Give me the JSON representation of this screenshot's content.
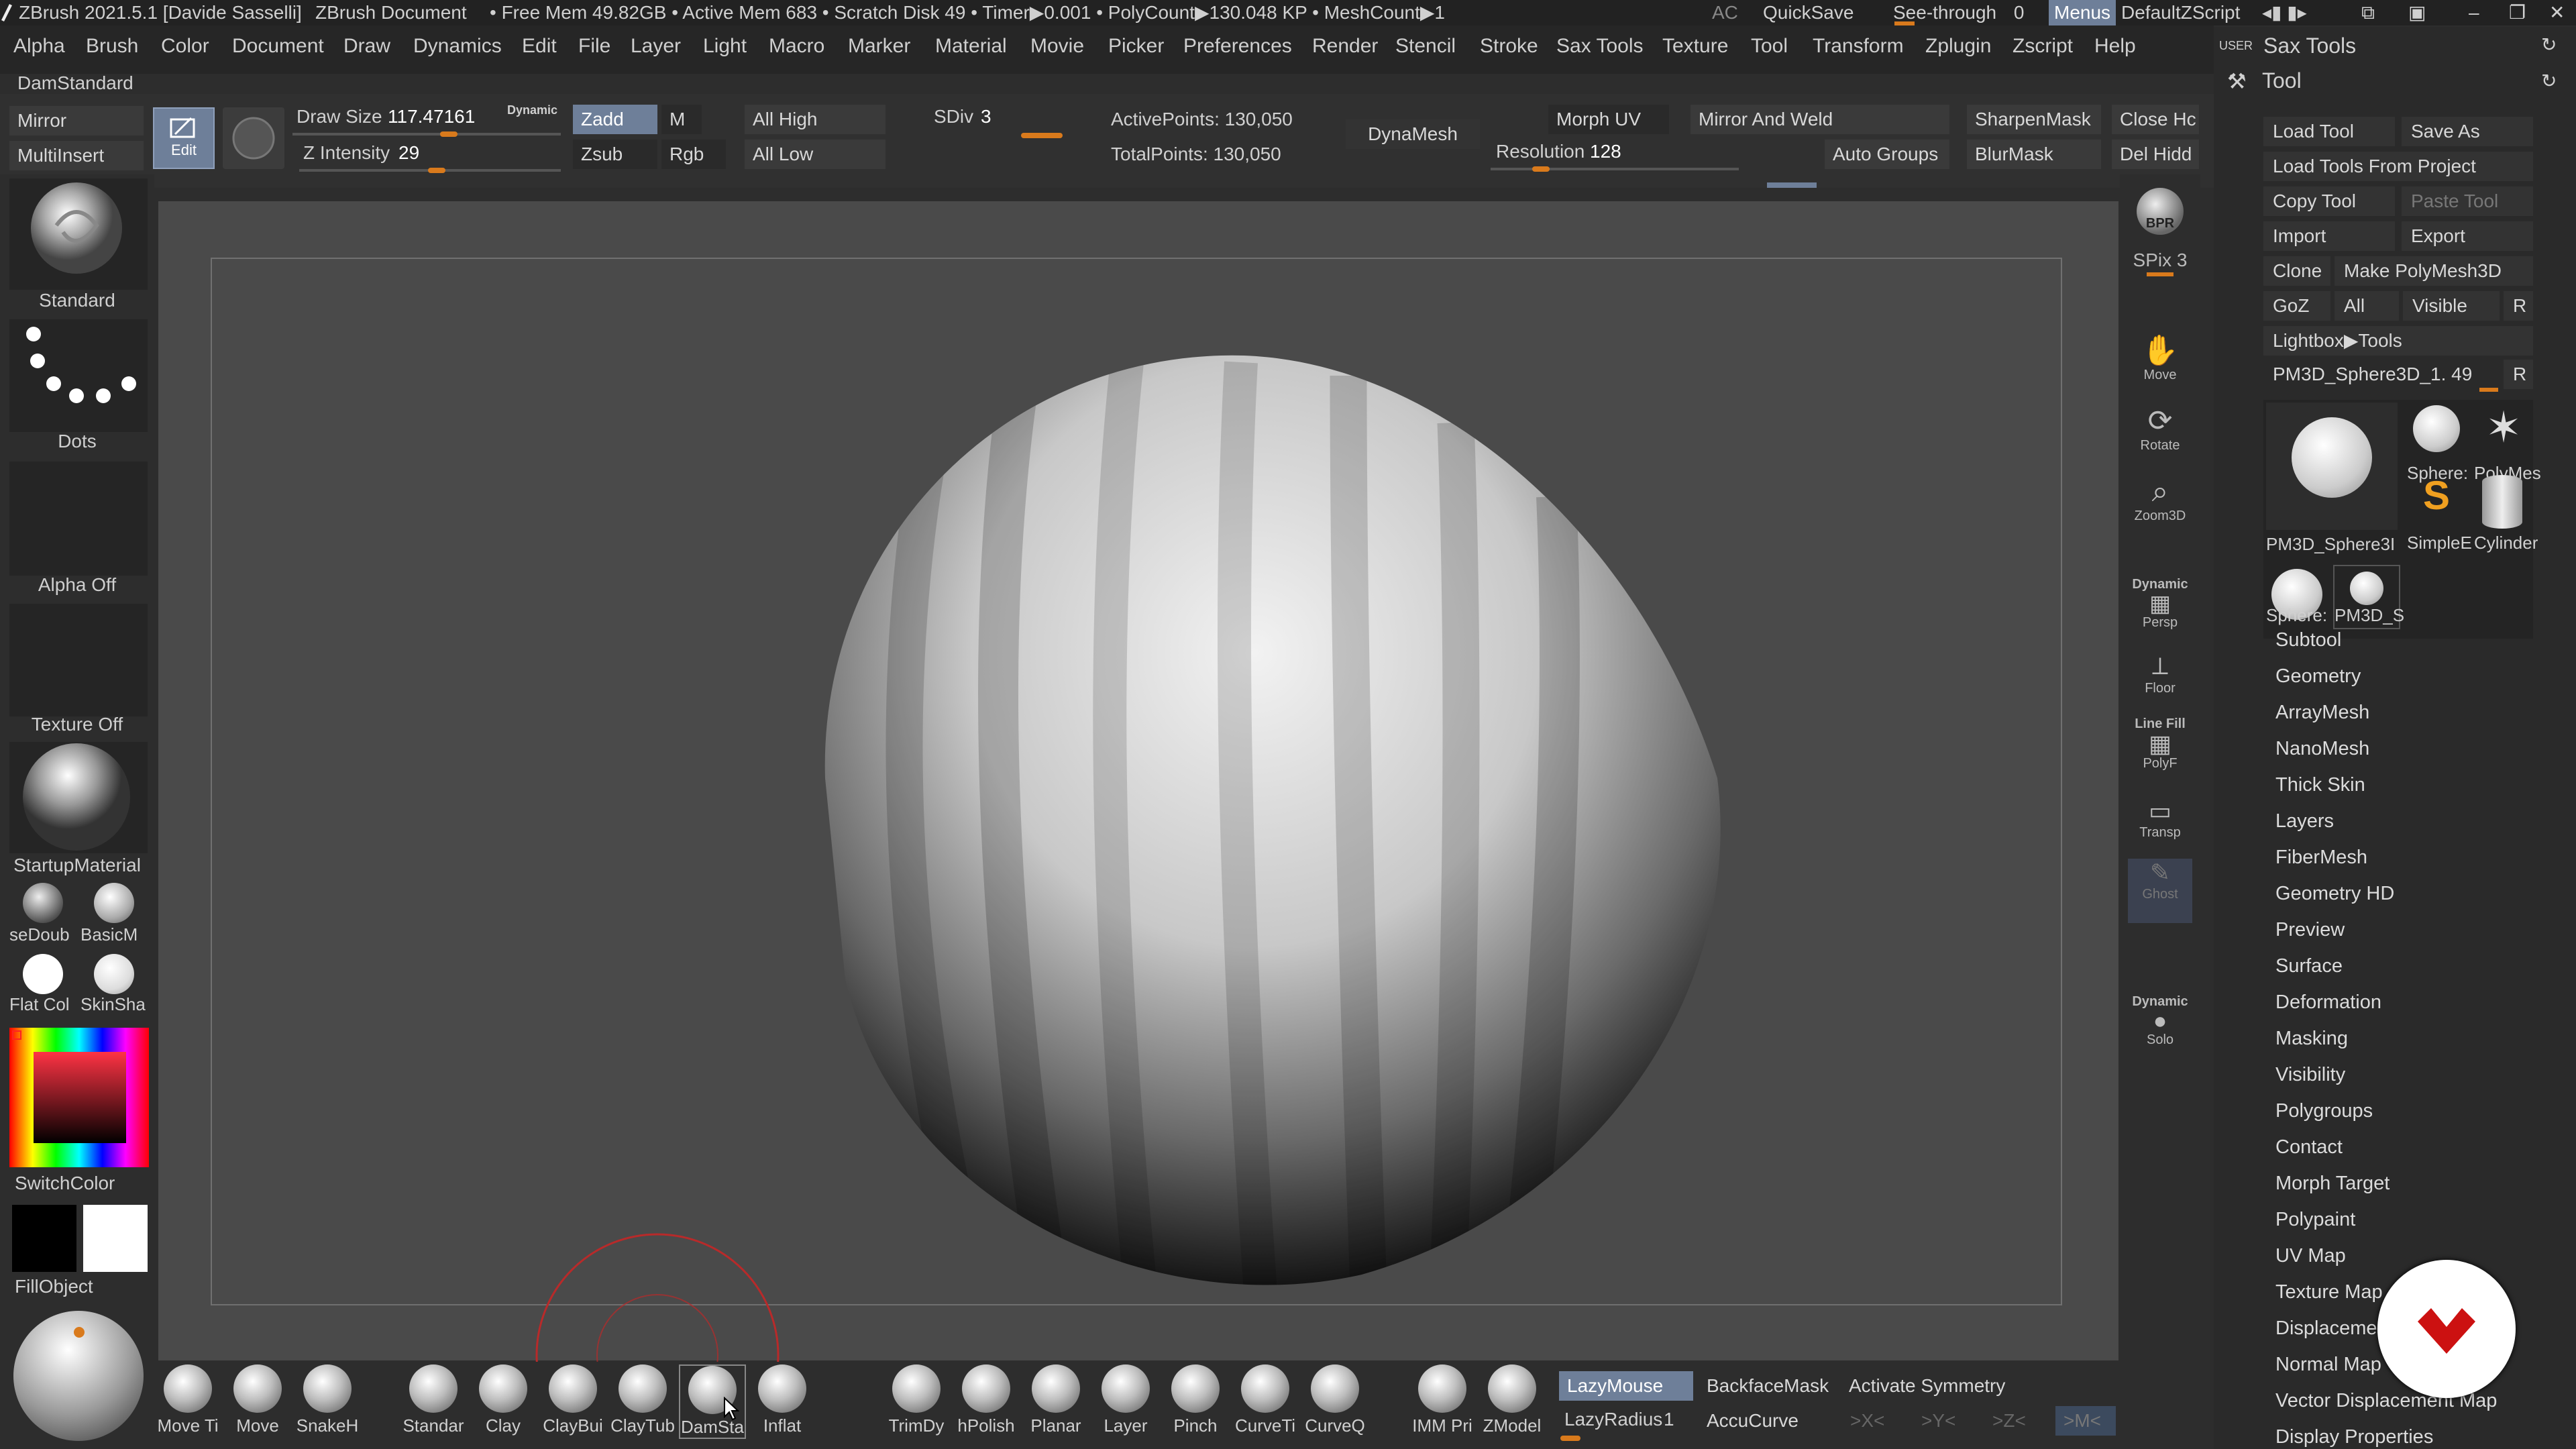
{
  "titlebar": {
    "app": "ZBrush 2021.5.1 [Davide Sasselli]",
    "doc": "ZBrush Document",
    "stats": "• Free Mem 49.82GB • Active Mem 683 • Scratch Disk 49 • Timer▶0.001 • PolyCount▶130.048 KP • MeshCount▶1",
    "ac": "AC",
    "quicksave": "QuickSave",
    "seethrough": "See-through",
    "seethrough_val": "0",
    "menus": "Menus",
    "script": "DefaultZScript"
  },
  "menus": [
    "Alpha",
    "Brush",
    "Color",
    "Document",
    "Draw",
    "Dynamics",
    "Edit",
    "File",
    "Layer",
    "Light",
    "Macro",
    "Marker",
    "Material",
    "Movie",
    "Picker",
    "Preferences",
    "Render",
    "Stencil",
    "Stroke",
    "Sax Tools",
    "Texture",
    "Tool",
    "Transform",
    "Zplugin",
    "Zscript",
    "Help"
  ],
  "current_brush": "DamStandard",
  "shelf": {
    "mirror": "Mirror",
    "multiinsert": "MultiInsert",
    "edit": "Edit",
    "draw_size_label": "Draw Size",
    "draw_size_value": "117.47161",
    "dynamic": "Dynamic",
    "z_intensity_label": "Z Intensity",
    "z_intensity_value": "29",
    "zadd": "Zadd",
    "zsub": "Zsub",
    "m": "M",
    "rgb": "Rgb",
    "all_high": "All High",
    "all_low": "All Low",
    "sdiv_label": "SDiv",
    "sdiv_value": "3",
    "active_points": "ActivePoints: 130,050",
    "total_points": "TotalPoints: 130,050",
    "dynamesh": "DynaMesh",
    "morph_uv": "Morph UV",
    "resolution_label": "Resolution",
    "resolution_value": "128",
    "mirror_weld": "Mirror And Weld",
    "auto_groups": "Auto Groups",
    "sharpenmask": "SharpenMask",
    "blurmask": "BlurMask",
    "close_holes": "Close Hc",
    "del_hidden": "Del Hidd"
  },
  "left": {
    "standard": "Standard",
    "dots": "Dots",
    "alpha_off": "Alpha Off",
    "texture_off": "Texture Off",
    "startup_material": "StartupMaterial",
    "mat1": "seDoub",
    "mat2": "BasicM",
    "mat3": "Flat Col",
    "mat4": "SkinSha",
    "switch_color": "SwitchColor",
    "fill_object": "FillObject"
  },
  "right": {
    "bpr": "BPR",
    "spix_label": "SPix",
    "spix_value": "3",
    "move": "Move",
    "rotate": "Rotate",
    "zoom3d": "Zoom3D",
    "dynamic": "Dynamic",
    "persp": "Persp",
    "floor": "Floor",
    "linefill": "Line Fill",
    "polyf": "PolyF",
    "transp": "Transp",
    "ghost": "Ghost",
    "dynamic2": "Dynamic",
    "solo": "Solo"
  },
  "toolpanel": {
    "user": "USER",
    "sax_tools": "Sax Tools",
    "tool": "Tool",
    "load_tool": "Load Tool",
    "save_as": "Save As",
    "load_from_project": "Load Tools From Project",
    "copy_tool": "Copy Tool",
    "paste_tool": "Paste Tool",
    "import": "Import",
    "export": "Export",
    "clone": "Clone",
    "make_polymesh": "Make PolyMesh3D",
    "goz": "GoZ",
    "all": "All",
    "visible": "Visible",
    "r": "R",
    "lightbox_tools": "Lightbox▶Tools",
    "current_tool": "PM3D_Sphere3D_1. 49",
    "r2": "R",
    "thumb_main": "PM3D_Sphere3I",
    "thumb_sphere": "Sphere:",
    "thumb_polymesh": "PolyMes",
    "thumb_simple": "SimpleE",
    "thumb_cylinder": "Cylinder",
    "thumb_sphere2": "Sphere:",
    "thumb_pm3d": "PM3D_S",
    "sections": [
      "Subtool",
      "Geometry",
      "ArrayMesh",
      "NanoMesh",
      "Thick Skin",
      "Layers",
      "FiberMesh",
      "Geometry HD",
      "Preview",
      "Surface",
      "Deformation",
      "Masking",
      "Visibility",
      "Polygroups",
      "Contact",
      "Morph Target",
      "Polypaint",
      "UV Map",
      "Texture Map",
      "Displacement",
      "Normal Map",
      "Vector Displacement Map",
      "Display Properties"
    ]
  },
  "bottom": {
    "brushes": [
      "Move Ti",
      "Move",
      "SnakeH",
      "Standar",
      "Clay",
      "ClayBui",
      "ClayTub",
      "DamSta",
      "Inflat",
      "TrimDy",
      "hPolish",
      "Planar",
      "Layer",
      "Pinch",
      "CurveTi",
      "CurveQ",
      "IMM Pri",
      "ZModel"
    ],
    "lazymouse": "LazyMouse",
    "lazyradius_label": "LazyRadius",
    "lazyradius_value": "1",
    "backfacemask": "BackfaceMask",
    "accucurve": "AccuCurve",
    "activate_symmetry": "Activate Symmetry",
    "x": ">X<",
    "y": ">Y<",
    "z": ">Z<",
    "m": ">M<"
  },
  "colors": {
    "accent": "#d97a1c",
    "active_button": "#6e7f99",
    "logo": "#cc1111"
  }
}
